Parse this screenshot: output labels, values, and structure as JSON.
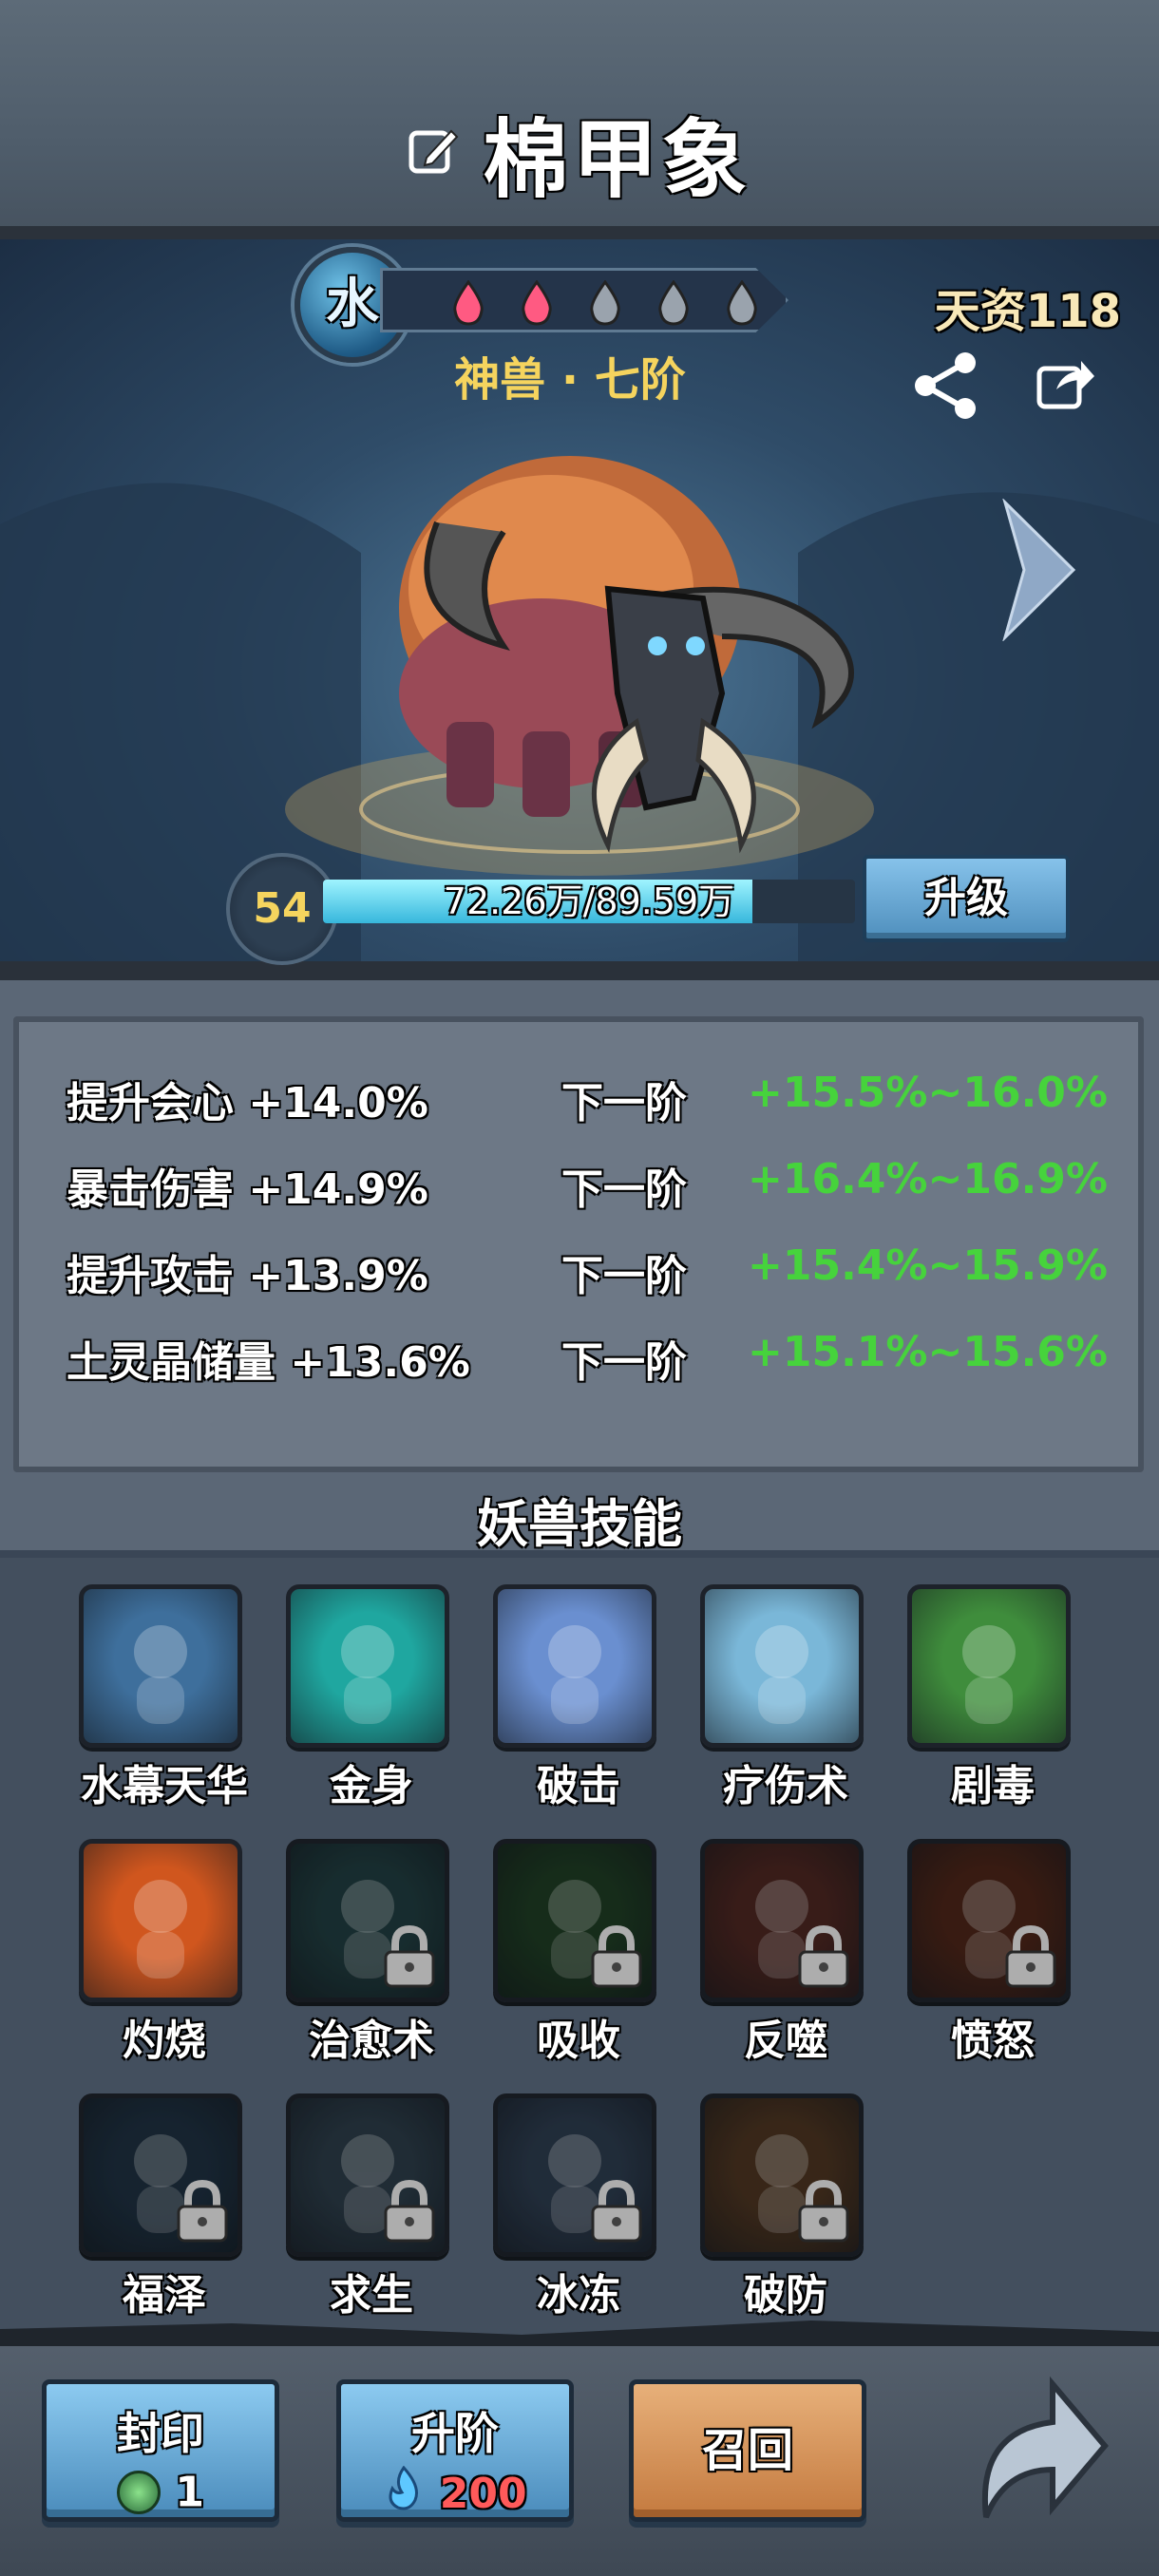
{
  "title": "棉甲象",
  "element": "水",
  "stars": {
    "filled": 2,
    "total": 5
  },
  "rank": "神兽 · 七阶",
  "talent": "天资118",
  "level": "54",
  "exp": {
    "text": "72.26万/89.59万",
    "fraction": 0.807
  },
  "upgrade_label": "升级",
  "stats": [
    {
      "name": "提升会心 +14.0%",
      "next": "下一阶",
      "range": "+15.5%~16.0%"
    },
    {
      "name": "暴击伤害 +14.9%",
      "next": "下一阶",
      "range": "+16.4%~16.9%"
    },
    {
      "name": "提升攻击 +13.9%",
      "next": "下一阶",
      "range": "+15.4%~15.9%"
    },
    {
      "name": "土灵晶储量 +13.6%",
      "next": "下一阶",
      "range": "+15.1%~15.6%"
    }
  ],
  "skills_title": "妖兽技能",
  "skills": [
    {
      "name": "水幕天华",
      "locked": false,
      "color": "#3e6f9c"
    },
    {
      "name": "金身",
      "locked": false,
      "color": "#1fa7a0"
    },
    {
      "name": "破击",
      "locked": false,
      "color": "#6a8fd0"
    },
    {
      "name": "疗伤术",
      "locked": false,
      "color": "#7ab7d8"
    },
    {
      "name": "剧毒",
      "locked": false,
      "color": "#3f8d3c"
    },
    {
      "name": "灼烧",
      "locked": false,
      "color": "#d0561e"
    },
    {
      "name": "治愈术",
      "locked": true,
      "color": "#1f3b3e"
    },
    {
      "name": "吸收",
      "locked": true,
      "color": "#1d3a22"
    },
    {
      "name": "反噬",
      "locked": true,
      "color": "#4a2520"
    },
    {
      "name": "愤怒",
      "locked": true,
      "color": "#4a2418"
    },
    {
      "name": "福泽",
      "locked": true,
      "color": "#1d2f3f"
    },
    {
      "name": "求生",
      "locked": true,
      "color": "#2a3a46"
    },
    {
      "name": "冰冻",
      "locked": true,
      "color": "#2b3a4c"
    },
    {
      "name": "破防",
      "locked": true,
      "color": "#4a3320"
    }
  ],
  "buttons": {
    "seal": {
      "label": "封印",
      "cost": "1"
    },
    "advance": {
      "label": "升阶",
      "cost": "200"
    },
    "recall": {
      "label": "召回"
    }
  }
}
